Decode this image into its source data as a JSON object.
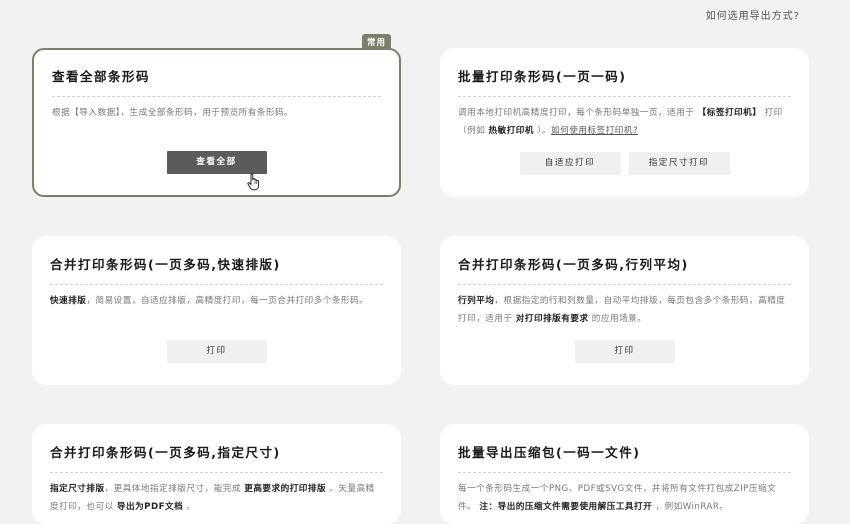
{
  "help_link": "如何选用导出方式?",
  "cards": [
    {
      "title": "查看全部条形码",
      "badge": "常用",
      "desc": [
        "根据【导入数据】，生成全部条形码，用于预览所有条形码。"
      ],
      "buttons": [
        "查看全部"
      ]
    },
    {
      "title": "批量打印条形码(一页一码)",
      "desc_parts": {
        "p1": "调用本地打印机高精度打印，每个条形码单独一页，适用于 ",
        "b1": "【标签打印机】",
        "p2": " 打印（例如 ",
        "b2": "热敏打印机",
        "p3": " ）。",
        "link": "如何使用标签打印机?"
      },
      "buttons": [
        "自适应打印",
        "指定尺寸打印"
      ]
    },
    {
      "title": "合并打印条形码(一页多码,快速排版)",
      "desc_parts": {
        "b1": "快速排版",
        "p1": "，简易设置，自适应排版，高精度打印，每一页合并打印多个条形码。"
      },
      "buttons": [
        "打印"
      ]
    },
    {
      "title": "合并打印条形码(一页多码,行列平均)",
      "desc_parts": {
        "b1": "行列平均",
        "p1": "，根据指定的行和列数量，自动平均排版，每页包含多个条形码，高精度打印，适用于 ",
        "b2": "对打印排版有要求",
        "p2": " 的应用场景。"
      },
      "buttons": [
        "打印"
      ]
    },
    {
      "title": "合并打印条形码(一页多码,指定尺寸)",
      "desc_parts": {
        "b1": "指定尺寸排版",
        "p1": "，更具体地指定排版尺寸，能完成 ",
        "b2": "更高要求的打印排版",
        "p2": " 。矢量高精度打印，也可以 ",
        "b3": "导出为PDF文档",
        "p3": " 。"
      }
    },
    {
      "title": "批量导出压缩包(一码一文件)",
      "desc_parts": {
        "p1": "每一个条形码生成一个PNG、PDF或SVG文件，并将所有文件打包成ZIP压缩文件。 ",
        "b1": "注：导出的压缩文件需要使用解压工具打开",
        "p2": " ，例如WinRAR。"
      }
    }
  ]
}
